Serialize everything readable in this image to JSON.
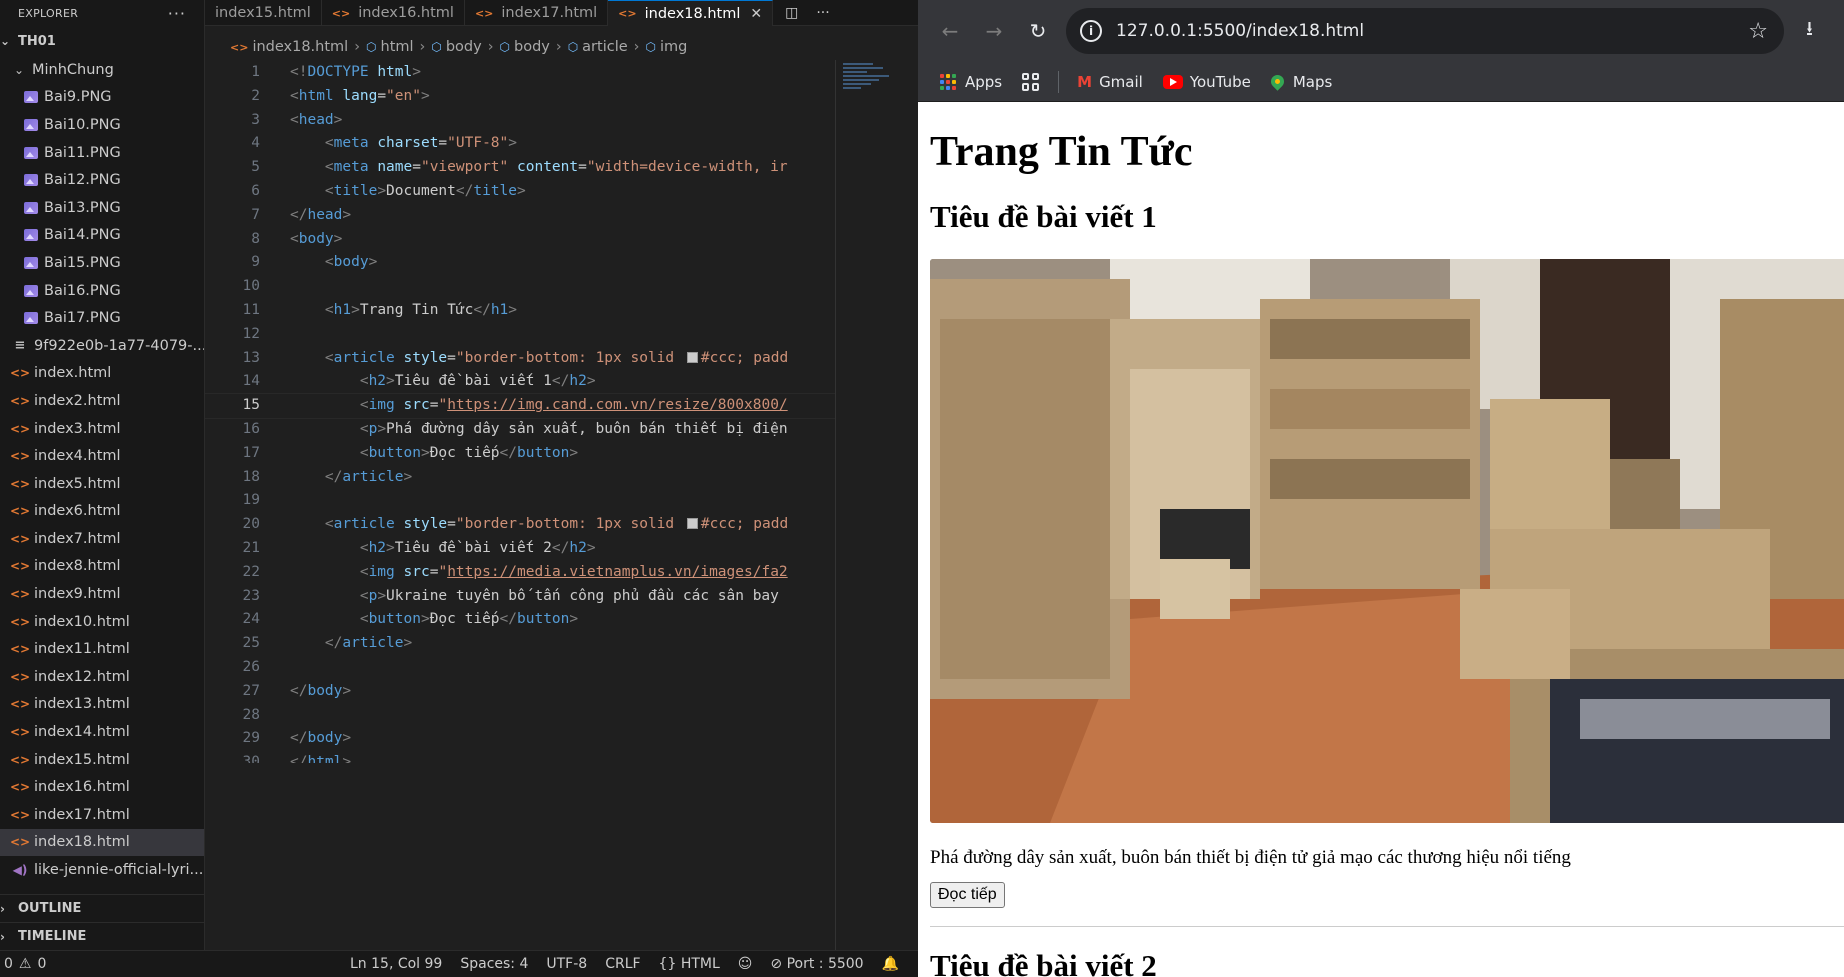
{
  "sidebar": {
    "header": "EXPLORER",
    "more_icon": "ellipsis-icon",
    "root": "TH01",
    "folder": "MinhChung",
    "folder_files": [
      "Bai9.PNG",
      "Bai10.PNG",
      "Bai11.PNG",
      "Bai12.PNG",
      "Bai13.PNG",
      "Bai14.PNG",
      "Bai15.PNG",
      "Bai16.PNG",
      "Bai17.PNG"
    ],
    "root_files": [
      {
        "name": "9f922e0b-1a77-4079-...",
        "icon": "lines-icon"
      },
      {
        "name": "index.html",
        "icon": "html-icon"
      },
      {
        "name": "index2.html",
        "icon": "html-icon"
      },
      {
        "name": "index3.html",
        "icon": "html-icon"
      },
      {
        "name": "index4.html",
        "icon": "html-icon"
      },
      {
        "name": "index5.html",
        "icon": "html-icon"
      },
      {
        "name": "index6.html",
        "icon": "html-icon"
      },
      {
        "name": "index7.html",
        "icon": "html-icon"
      },
      {
        "name": "index8.html",
        "icon": "html-icon"
      },
      {
        "name": "index9.html",
        "icon": "html-icon"
      },
      {
        "name": "index10.html",
        "icon": "html-icon"
      },
      {
        "name": "index11.html",
        "icon": "html-icon"
      },
      {
        "name": "index12.html",
        "icon": "html-icon"
      },
      {
        "name": "index13.html",
        "icon": "html-icon"
      },
      {
        "name": "index14.html",
        "icon": "html-icon"
      },
      {
        "name": "index15.html",
        "icon": "html-icon"
      },
      {
        "name": "index16.html",
        "icon": "html-icon"
      },
      {
        "name": "index17.html",
        "icon": "html-icon"
      },
      {
        "name": "index18.html",
        "icon": "html-icon",
        "selected": true
      },
      {
        "name": "like-jennie-official-lyri...",
        "icon": "audio-icon"
      }
    ],
    "outline": "OUTLINE",
    "timeline": "TIMELINE"
  },
  "tabs": [
    {
      "label": "index15.html",
      "active": false
    },
    {
      "label": "index16.html",
      "active": false
    },
    {
      "label": "index17.html",
      "active": false
    },
    {
      "label": "index18.html",
      "active": true
    }
  ],
  "breadcrumb": [
    "index18.html",
    "html",
    "body",
    "body",
    "article",
    "img"
  ],
  "editor": {
    "current_line": 15,
    "lines": [
      [
        [
          "p",
          "<!"
        ],
        [
          "t",
          "DOCTYPE"
        ],
        [
          "x",
          " "
        ],
        [
          "a",
          "html"
        ],
        [
          "p",
          ">"
        ]
      ],
      [
        [
          "p",
          "<"
        ],
        [
          "t",
          "html"
        ],
        [
          "x",
          " "
        ],
        [
          "a",
          "lang"
        ],
        [
          "x",
          "="
        ],
        [
          "v",
          "\"en\""
        ],
        [
          "p",
          ">"
        ]
      ],
      [
        [
          "p",
          "<"
        ],
        [
          "t",
          "head"
        ],
        [
          "p",
          ">"
        ]
      ],
      [
        [
          "x",
          "    "
        ],
        [
          "p",
          "<"
        ],
        [
          "t",
          "meta"
        ],
        [
          "x",
          " "
        ],
        [
          "a",
          "charset"
        ],
        [
          "x",
          "="
        ],
        [
          "v",
          "\"UTF-8\""
        ],
        [
          "p",
          ">"
        ]
      ],
      [
        [
          "x",
          "    "
        ],
        [
          "p",
          "<"
        ],
        [
          "t",
          "meta"
        ],
        [
          "x",
          " "
        ],
        [
          "a",
          "name"
        ],
        [
          "x",
          "="
        ],
        [
          "v",
          "\"viewport\""
        ],
        [
          "x",
          " "
        ],
        [
          "a",
          "content"
        ],
        [
          "x",
          "="
        ],
        [
          "v",
          "\"width=device-width, ir"
        ]
      ],
      [
        [
          "x",
          "    "
        ],
        [
          "p",
          "<"
        ],
        [
          "t",
          "title"
        ],
        [
          "p",
          ">"
        ],
        [
          "x",
          "Document"
        ],
        [
          "p",
          "</"
        ],
        [
          "t",
          "title"
        ],
        [
          "p",
          ">"
        ]
      ],
      [
        [
          "p",
          "</"
        ],
        [
          "t",
          "head"
        ],
        [
          "p",
          ">"
        ]
      ],
      [
        [
          "p",
          "<"
        ],
        [
          "t",
          "body"
        ],
        [
          "p",
          ">"
        ]
      ],
      [
        [
          "x",
          "    "
        ],
        [
          "p",
          "<"
        ],
        [
          "t",
          "body"
        ],
        [
          "p",
          ">"
        ]
      ],
      [],
      [
        [
          "x",
          "    "
        ],
        [
          "p",
          "<"
        ],
        [
          "t",
          "h1"
        ],
        [
          "p",
          ">"
        ],
        [
          "x",
          "Trang Tin Tức"
        ],
        [
          "p",
          "</"
        ],
        [
          "t",
          "h1"
        ],
        [
          "p",
          ">"
        ]
      ],
      [],
      [
        [
          "x",
          "    "
        ],
        [
          "p",
          "<"
        ],
        [
          "t",
          "article"
        ],
        [
          "x",
          " "
        ],
        [
          "a",
          "style"
        ],
        [
          "x",
          "="
        ],
        [
          "v",
          "\"border-bottom: 1px solid "
        ],
        [
          "s",
          ""
        ],
        [
          "v",
          "#ccc; padd"
        ]
      ],
      [
        [
          "x",
          "        "
        ],
        [
          "p",
          "<"
        ],
        [
          "t",
          "h2"
        ],
        [
          "p",
          ">"
        ],
        [
          "x",
          "Tiêu đề bài viết 1"
        ],
        [
          "p",
          "</"
        ],
        [
          "t",
          "h2"
        ],
        [
          "p",
          ">"
        ]
      ],
      [
        [
          "x",
          "        "
        ],
        [
          "p",
          "<"
        ],
        [
          "t",
          "img"
        ],
        [
          "x",
          " "
        ],
        [
          "a",
          "src"
        ],
        [
          "x",
          "="
        ],
        [
          "v",
          "\""
        ],
        [
          "l",
          "https://img.cand.com.vn/resize/800x800/"
        ]
      ],
      [
        [
          "x",
          "        "
        ],
        [
          "p",
          "<"
        ],
        [
          "t",
          "p"
        ],
        [
          "p",
          ">"
        ],
        [
          "x",
          "Phá đường dây sản xuất, buôn bán thiết bị điện"
        ]
      ],
      [
        [
          "x",
          "        "
        ],
        [
          "p",
          "<"
        ],
        [
          "t",
          "button"
        ],
        [
          "p",
          ">"
        ],
        [
          "x",
          "Đọc tiếp"
        ],
        [
          "p",
          "</"
        ],
        [
          "t",
          "button"
        ],
        [
          "p",
          ">"
        ]
      ],
      [
        [
          "x",
          "    "
        ],
        [
          "p",
          "</"
        ],
        [
          "t",
          "article"
        ],
        [
          "p",
          ">"
        ]
      ],
      [],
      [
        [
          "x",
          "    "
        ],
        [
          "p",
          "<"
        ],
        [
          "t",
          "article"
        ],
        [
          "x",
          " "
        ],
        [
          "a",
          "style"
        ],
        [
          "x",
          "="
        ],
        [
          "v",
          "\"border-bottom: 1px solid "
        ],
        [
          "s",
          ""
        ],
        [
          "v",
          "#ccc; padd"
        ]
      ],
      [
        [
          "x",
          "        "
        ],
        [
          "p",
          "<"
        ],
        [
          "t",
          "h2"
        ],
        [
          "p",
          ">"
        ],
        [
          "x",
          "Tiêu đề bài viết 2"
        ],
        [
          "p",
          "</"
        ],
        [
          "t",
          "h2"
        ],
        [
          "p",
          ">"
        ]
      ],
      [
        [
          "x",
          "        "
        ],
        [
          "p",
          "<"
        ],
        [
          "t",
          "img"
        ],
        [
          "x",
          " "
        ],
        [
          "a",
          "src"
        ],
        [
          "x",
          "="
        ],
        [
          "v",
          "\""
        ],
        [
          "l",
          "https://media.vietnamplus.vn/images/fa2"
        ]
      ],
      [
        [
          "x",
          "        "
        ],
        [
          "p",
          "<"
        ],
        [
          "t",
          "p"
        ],
        [
          "p",
          ">"
        ],
        [
          "x",
          "Ukraine tuyên bố tấn công phủ đầu các sân bay"
        ]
      ],
      [
        [
          "x",
          "        "
        ],
        [
          "p",
          "<"
        ],
        [
          "t",
          "button"
        ],
        [
          "p",
          ">"
        ],
        [
          "x",
          "Đọc tiếp"
        ],
        [
          "p",
          "</"
        ],
        [
          "t",
          "button"
        ],
        [
          "p",
          ">"
        ]
      ],
      [
        [
          "x",
          "    "
        ],
        [
          "p",
          "</"
        ],
        [
          "t",
          "article"
        ],
        [
          "p",
          ">"
        ]
      ],
      [],
      [
        [
          "p",
          "</"
        ],
        [
          "t",
          "body"
        ],
        [
          "p",
          ">"
        ]
      ],
      [],
      [
        [
          "p",
          "</"
        ],
        [
          "t",
          "body"
        ],
        [
          "p",
          ">"
        ]
      ],
      [
        [
          "p",
          "</"
        ],
        [
          "t",
          "html"
        ],
        [
          "p",
          ">"
        ]
      ]
    ]
  },
  "status": {
    "errors": "0",
    "warnings": "0",
    "position": "Ln 15, Col 99",
    "spaces": "Spaces: 4",
    "encoding": "UTF-8",
    "eol": "CRLF",
    "language": "HTML",
    "port": "Port : 5500"
  },
  "browser": {
    "url": "127.0.0.1:5500/index18.html",
    "bookmarks": [
      "Apps",
      "Gmail",
      "YouTube",
      "Maps"
    ]
  },
  "page": {
    "h1": "Trang Tin Tức",
    "article1": {
      "title": "Tiêu đề bài viết 1",
      "text": "Phá đường dây sản xuất, buôn bán thiết bị điện tử giả mạo các thương hiệu nổi tiếng",
      "button": "Đọc tiếp"
    },
    "article2": {
      "title": "Tiêu đề bài viết 2"
    }
  }
}
